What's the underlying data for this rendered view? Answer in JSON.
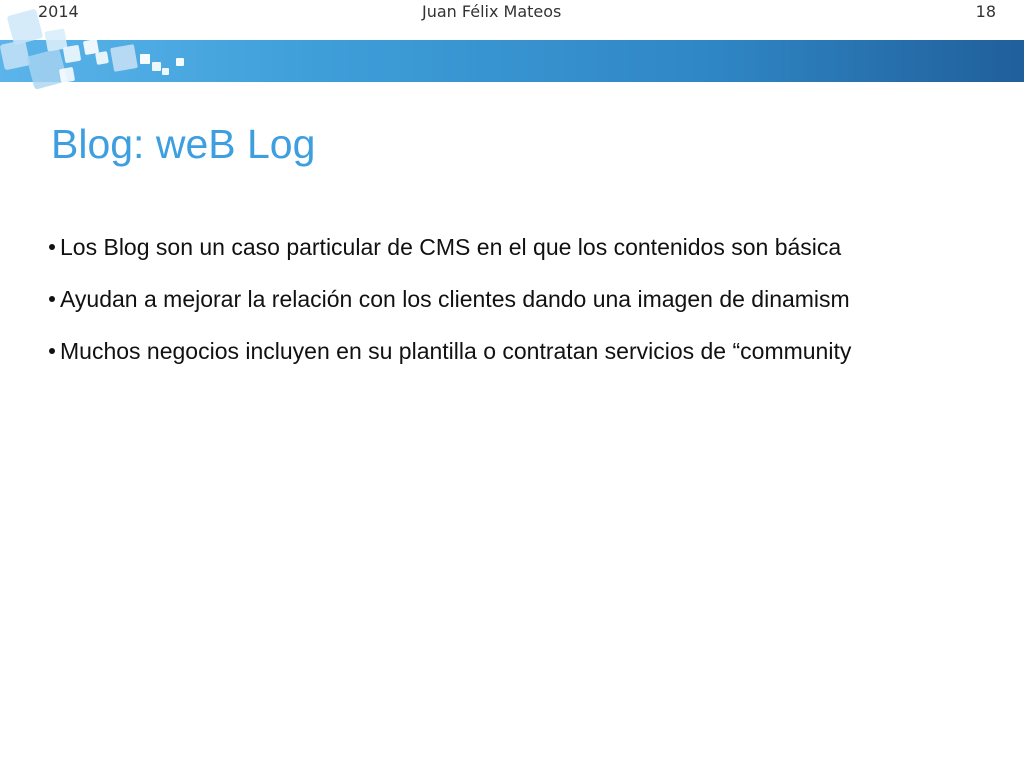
{
  "header": {
    "year": "2014",
    "author": "Juan Félix Mateos",
    "page_number": "18"
  },
  "slide": {
    "title": "Blog: weB Log",
    "bullets": [
      "Los Blog son un caso particular de CMS en el que los contenidos son básica",
      "Ayudan a mejorar la relación con los clientes dando una imagen de dinamism",
      "Muchos negocios incluyen en su plantilla o contratan servicios de “community"
    ]
  },
  "colors": {
    "title": "#3d9ee0",
    "band_start": "#5bb4ea",
    "band_end": "#205f9b",
    "text": "#111111"
  },
  "icons": [
    "decorative-squares"
  ]
}
